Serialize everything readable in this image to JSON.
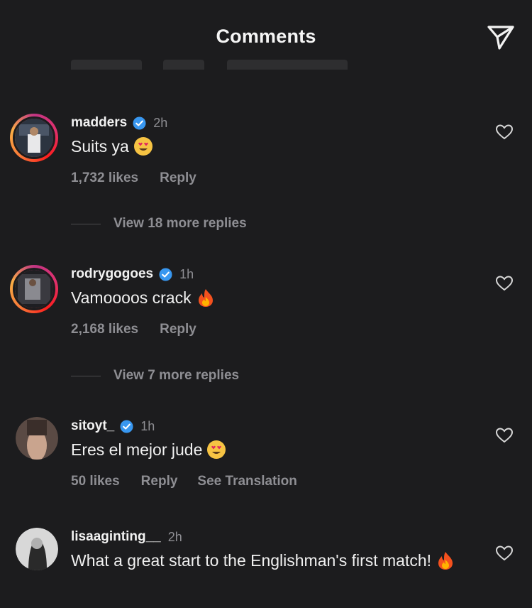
{
  "header": {
    "title": "Comments"
  },
  "comments": [
    {
      "username": "madders",
      "verified": true,
      "time": "2h",
      "text": "Suits ya",
      "emoji": "smiling-face-with-heart-eyes",
      "likes": "1,732 likes",
      "reply": "Reply",
      "view_more": "View 18 more replies"
    },
    {
      "username": "rodrygogoes",
      "verified": true,
      "time": "1h",
      "text": "Vamoooos crack",
      "emoji": "fire",
      "likes": "2,168 likes",
      "reply": "Reply",
      "view_more": "View 7 more replies"
    },
    {
      "username": "sitoyt_",
      "verified": true,
      "time": "1h",
      "text": "Eres el mejor jude",
      "emoji": "smiling-face-with-heart-eyes",
      "likes": "50 likes",
      "reply": "Reply",
      "translation": "See Translation"
    },
    {
      "username": "lisaaginting__",
      "verified": false,
      "time": "2h",
      "text": "What a great start to the Englishman's first match!",
      "emoji": "fire"
    }
  ],
  "colors": {
    "background": "#1c1c1e",
    "muted": "#8e8e93",
    "verified": "#3897f0"
  }
}
